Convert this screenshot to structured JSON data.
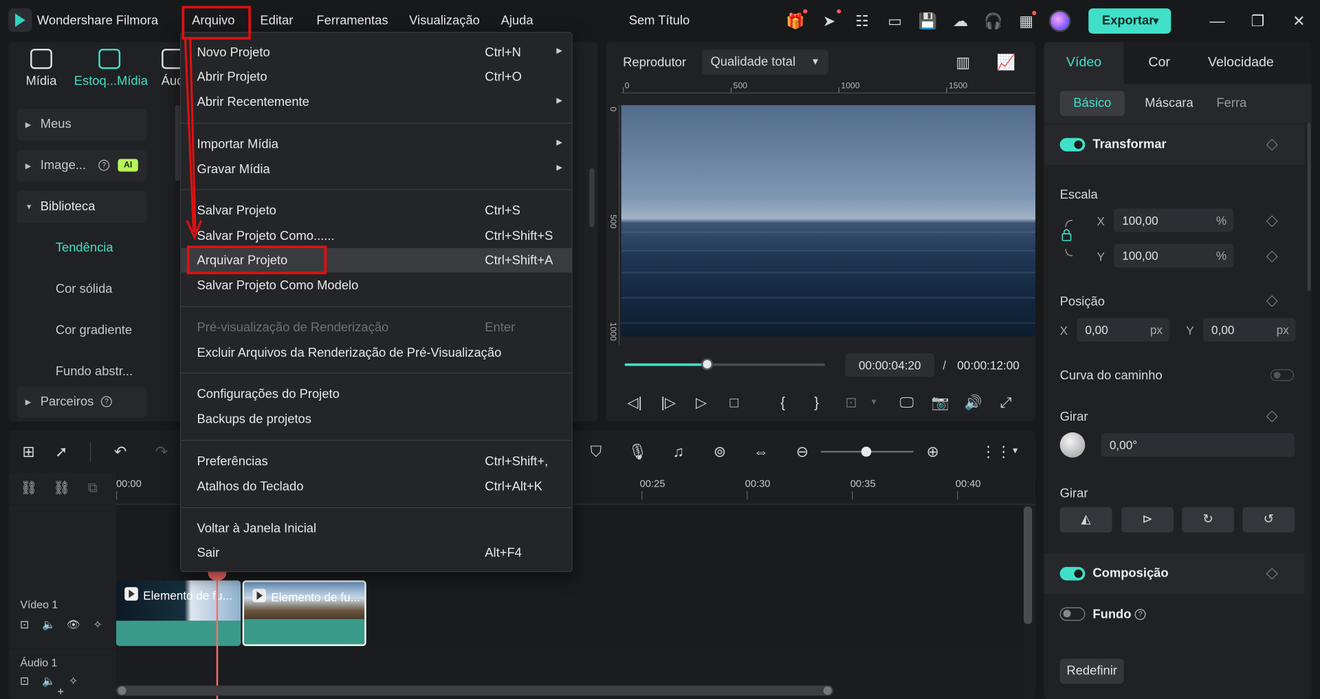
{
  "app": {
    "name": "Wondershare Filmora",
    "doc_title": "Sem Título",
    "export_label": "Exportar"
  },
  "menubar": [
    "Arquivo",
    "Editar",
    "Ferramentas",
    "Visualização",
    "Ajuda"
  ],
  "media_tabs": [
    {
      "label": "Mídia",
      "icon": "media-icon",
      "active": false
    },
    {
      "label": "Estoq...Mídia",
      "icon": "stock-media-icon",
      "active": true
    },
    {
      "label": "Áud",
      "icon": "audio-icon",
      "active": false
    }
  ],
  "library_nav": {
    "meus": "Meus",
    "images": "Image...",
    "ai_badge": "AI",
    "biblioteca": "Biblioteca",
    "sub_items": [
      "Tendência",
      "Cor sólida",
      "Cor gradiente",
      "Fundo abstr..."
    ],
    "partners": "Parceiros"
  },
  "player": {
    "label": "Reprodutor",
    "quality": "Qualidade total",
    "ruler_h": [
      "0",
      "500",
      "1000",
      "1500"
    ],
    "ruler_v": [
      "0",
      "500",
      "1000"
    ],
    "current_time": "00:00:04:20",
    "separator": "/",
    "total_time": "00:00:12:00",
    "progress": 0.41
  },
  "file_menu": {
    "items": [
      {
        "label": "Novo Projeto",
        "shortcut": "Ctrl+N",
        "submenu": true
      },
      {
        "label": "Abrir Projeto",
        "shortcut": "Ctrl+O"
      },
      {
        "label": "Abrir Recentemente",
        "submenu": true
      },
      {
        "label": "Importar Mídia",
        "submenu": true
      },
      {
        "label": "Gravar Mídia",
        "submenu": true
      },
      {
        "label": "Salvar Projeto",
        "shortcut": "Ctrl+S"
      },
      {
        "label": "Salvar Projeto Como......",
        "shortcut": "Ctrl+Shift+S"
      },
      {
        "label": "Arquivar Projeto",
        "shortcut": "Ctrl+Shift+A",
        "highlighted": true
      },
      {
        "label": "Salvar Projeto Como Modelo"
      },
      {
        "label": "Pré-visualização de Renderização",
        "shortcut": "Enter",
        "disabled": true
      },
      {
        "label": "Excluir Arquivos da Renderização de Pré-Visualização"
      },
      {
        "label": "Configurações do Projeto"
      },
      {
        "label": "Backups de projetos"
      },
      {
        "label": "Preferências",
        "shortcut": "Ctrl+Shift+,"
      },
      {
        "label": "Atalhos do Teclado",
        "shortcut": "Ctrl+Alt+K"
      },
      {
        "label": "Voltar à Janela Inicial"
      },
      {
        "label": "Sair",
        "shortcut": "Alt+F4"
      }
    ]
  },
  "properties": {
    "tabs": [
      "Vídeo",
      "Cor",
      "Velocidade"
    ],
    "sub_tabs": [
      "Básico",
      "Máscara",
      "Ferra"
    ],
    "transform": "Transformar",
    "scale": "Escala",
    "scale_x": "100,00",
    "scale_y": "100,00",
    "percent": "%",
    "position": "Posição",
    "pos_x": "0,00",
    "pos_y": "0,00",
    "px": "px",
    "axis_x": "X",
    "axis_y": "Y",
    "path_curve": "Curva do caminho",
    "rotate": "Girar",
    "rotate_value": "0,00°",
    "flip": "Girar",
    "composition": "Composição",
    "background": "Fundo",
    "reset": "Redefinir"
  },
  "timeline": {
    "ruler": [
      "00:00",
      "00:25",
      "00:30",
      "00:35",
      "00:40"
    ],
    "video_track": "Vídeo 1",
    "audio_track": "Áudio 1",
    "clips": [
      "Elemento de fu...",
      "Elemento de fu..."
    ]
  },
  "colors": {
    "accent": "#40e0c8",
    "annotation": "#e01010",
    "playhead": "#ff6b6b"
  }
}
